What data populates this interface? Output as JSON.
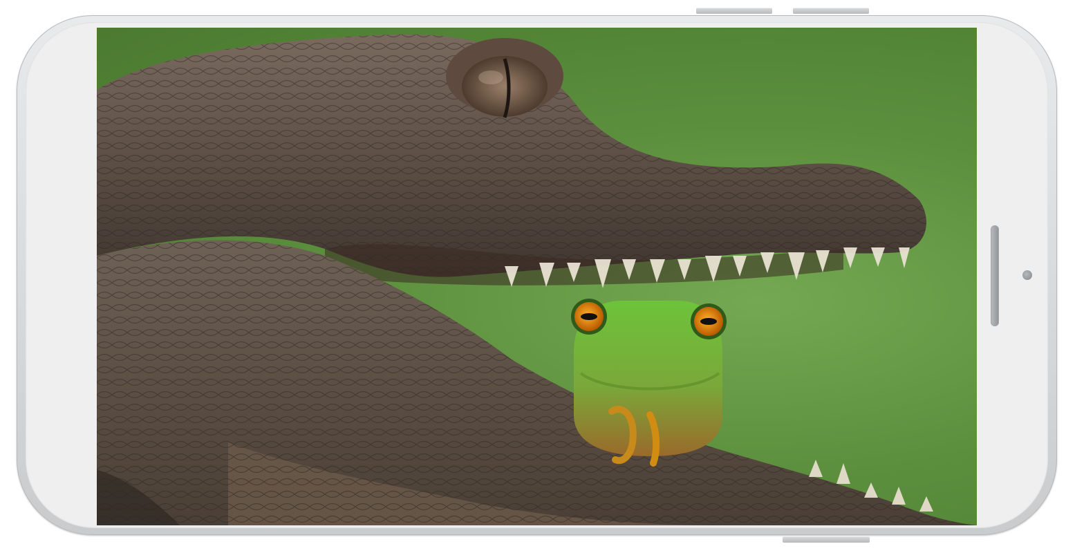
{
  "device": {
    "type": "smartphone-landscape",
    "frame_color": "#e9eaeb",
    "face_color": "#efefef"
  },
  "screen": {
    "content": "photo",
    "background_color": "#5b8f3d"
  },
  "icons": {
    "speaker": "speaker-icon",
    "sensor": "front-sensor-icon"
  }
}
